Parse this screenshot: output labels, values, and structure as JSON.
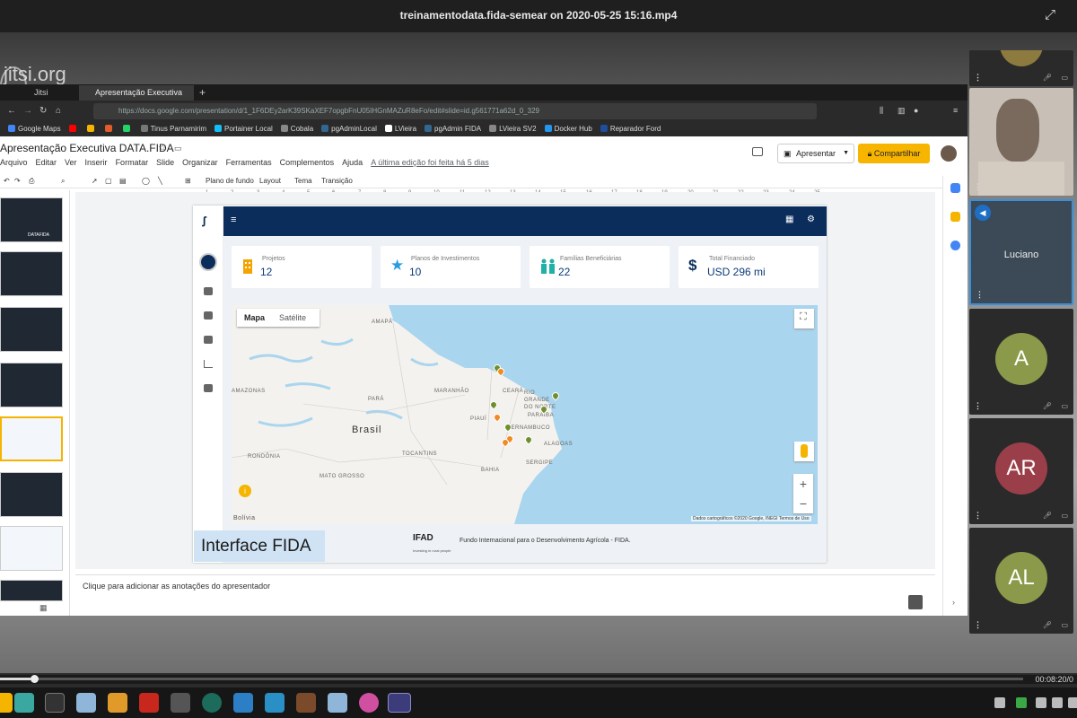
{
  "player": {
    "title": "treinamentodata.fida-semear on 2020-05-25 15:16.mp4",
    "timecode": "00:08:20/0",
    "progress_fraction": 0.03
  },
  "watermark": {
    "text": "jitsi.org"
  },
  "browser": {
    "tabs": [
      {
        "label": "Jitsi"
      },
      {
        "label": "Apresentação Executiva DA"
      }
    ],
    "new_tab_label": "+",
    "url": "https://docs.google.com/presentation/d/1_1F6DEy2arK39SKaXEF7opgbFnU05IHGnMAZuR8eFo/edit#slide=id.g561771a62d_0_329",
    "bookmarks": [
      {
        "label": "Google Maps",
        "color": "#4285f4"
      },
      {
        "label": "",
        "color": "#ff0000"
      },
      {
        "label": "",
        "color": "#f4b400"
      },
      {
        "label": "",
        "color": "#e25b2b"
      },
      {
        "label": "",
        "color": "#25d366"
      },
      {
        "label": "Tinus Parnamirim",
        "color": "#777777"
      },
      {
        "label": "Portainer Local",
        "color": "#13bef9"
      },
      {
        "label": "Cobala",
        "color": "#888888"
      },
      {
        "label": "pgAdminLocal",
        "color": "#336791"
      },
      {
        "label": "LVieira",
        "color": "#ffffff"
      },
      {
        "label": "pgAdmin FIDA",
        "color": "#336791"
      },
      {
        "label": "LVieira SV2",
        "color": "#888888"
      },
      {
        "label": "Docker Hub",
        "color": "#2496ed"
      },
      {
        "label": "Reparador Ford",
        "color": "#1f4e9c"
      }
    ]
  },
  "slides_app": {
    "doc_title": "Apresentação Executiva DATA.FIDA",
    "menu": [
      "Arquivo",
      "Editar",
      "Ver",
      "Inserir",
      "Formatar",
      "Slide",
      "Organizar",
      "Ferramentas",
      "Complementos",
      "Ajuda"
    ],
    "last_edit": "A última edição foi feita há 5 dias",
    "present_label": "Apresentar",
    "share_label": "Compartilhar",
    "toolbar": {
      "background": "Plano de fundo",
      "layout": "Layout",
      "theme": "Tema",
      "transition": "Transição"
    },
    "ruler": [
      "1",
      "2",
      "3",
      "4",
      "5",
      "6",
      "7",
      "8",
      "9",
      "10",
      "11",
      "12",
      "13",
      "14",
      "15",
      "16",
      "17",
      "18",
      "19",
      "20",
      "21",
      "22",
      "23",
      "24",
      "25"
    ],
    "thumb_label": "DATAFIDA",
    "notes_placeholder": "Clique para adicionar as anotações do apresentador"
  },
  "slide": {
    "stats": [
      {
        "label": "Projetos",
        "value": "12",
        "icon": "building-icon",
        "color": "#f4a300"
      },
      {
        "label": "Planos de Investimentos",
        "value": "10",
        "icon": "star-icon",
        "color": "#2b9be0"
      },
      {
        "label": "Famílias Beneficiárias",
        "value": "22",
        "icon": "family-icon",
        "color": "#1fb1a8"
      },
      {
        "label": "Total Financiado",
        "value": "USD 296 mi",
        "icon": "dollar-icon",
        "color": "#0b2d5b"
      }
    ],
    "map": {
      "type_map": "Mapa",
      "type_satellite": "Satélite",
      "country_label": "Brasil",
      "labels": [
        "AMAPÁ",
        "AMAZONAS",
        "PARÁ",
        "MARANHÃO",
        "CEARÁ",
        "RIO GRANDE DO NORTE",
        "PIAUÍ",
        "PARAÍBA",
        "PERNAMBUCO",
        "ALAGOAS",
        "TOCANTINS",
        "SERGIPE",
        "BAHIA",
        "RONDÔNIA",
        "MATO GROSSO",
        "Bolívia"
      ],
      "attribution": "Dados cartográficos ©2020 Google, INEGI   Termos de Uso",
      "zoom_in": "+",
      "zoom_out": "−"
    },
    "caption": "Interface FIDA",
    "ifad_logo": "IFAD",
    "ifad_tagline": "Investing in rural people",
    "ifad_desc": "Fundo Internacional para o Desenvolvimento Agrícola - FIDA."
  },
  "participants": [
    {
      "initials": "",
      "color": "#8d7a3e"
    },
    {
      "initials": "",
      "color": "#c8c0b6",
      "camera": true
    },
    {
      "name": "Luciano",
      "initials": "",
      "color": "#3b4a56"
    },
    {
      "initials": "A",
      "color": "#8a9a4a"
    },
    {
      "initials": "AR",
      "color": "#9a3f4a"
    },
    {
      "initials": "AL",
      "color": "#8a9a4a"
    }
  ]
}
